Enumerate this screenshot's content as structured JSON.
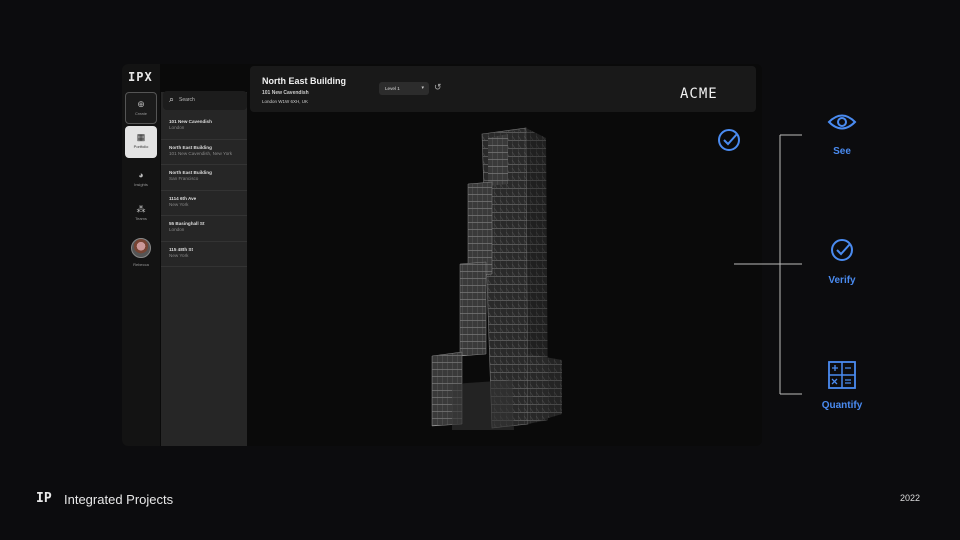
{
  "app": {
    "logo": "IPX",
    "rail": [
      {
        "label": "Create",
        "icon": "plus-icon"
      },
      {
        "label": "Portfolio",
        "icon": "grid-icon"
      },
      {
        "label": "Insights",
        "icon": "pie-chart-icon"
      },
      {
        "label": "Teams",
        "icon": "people-icon"
      }
    ],
    "user_name": "Rebecca",
    "search_placeholder": "Search",
    "buildings": [
      {
        "name": "101 New Cavendish",
        "location": "London"
      },
      {
        "name": "North East Building",
        "location": "101 New Cavendish, New York"
      },
      {
        "name": "North East Building",
        "location": "San Francisco"
      },
      {
        "name": "1114 6th Ave",
        "location": "New York"
      },
      {
        "name": "55 Basinghall St",
        "location": "London"
      },
      {
        "name": "115 48th St",
        "location": "New York"
      }
    ],
    "header": {
      "title": "North East Building",
      "address": "101 New Cavendish",
      "city": "London W1W 6XH, UK",
      "level": "Level 1",
      "client_logo": "ACME"
    }
  },
  "features": [
    {
      "label": "See",
      "icon": "eye-icon"
    },
    {
      "label": "Verify",
      "icon": "check-circle-icon"
    },
    {
      "label": "Quantify",
      "icon": "calculator-icon"
    }
  ],
  "accent_color": "#4a8bf0",
  "footer": {
    "logo": "IP",
    "company": "Integrated Projects",
    "year": "2022"
  }
}
